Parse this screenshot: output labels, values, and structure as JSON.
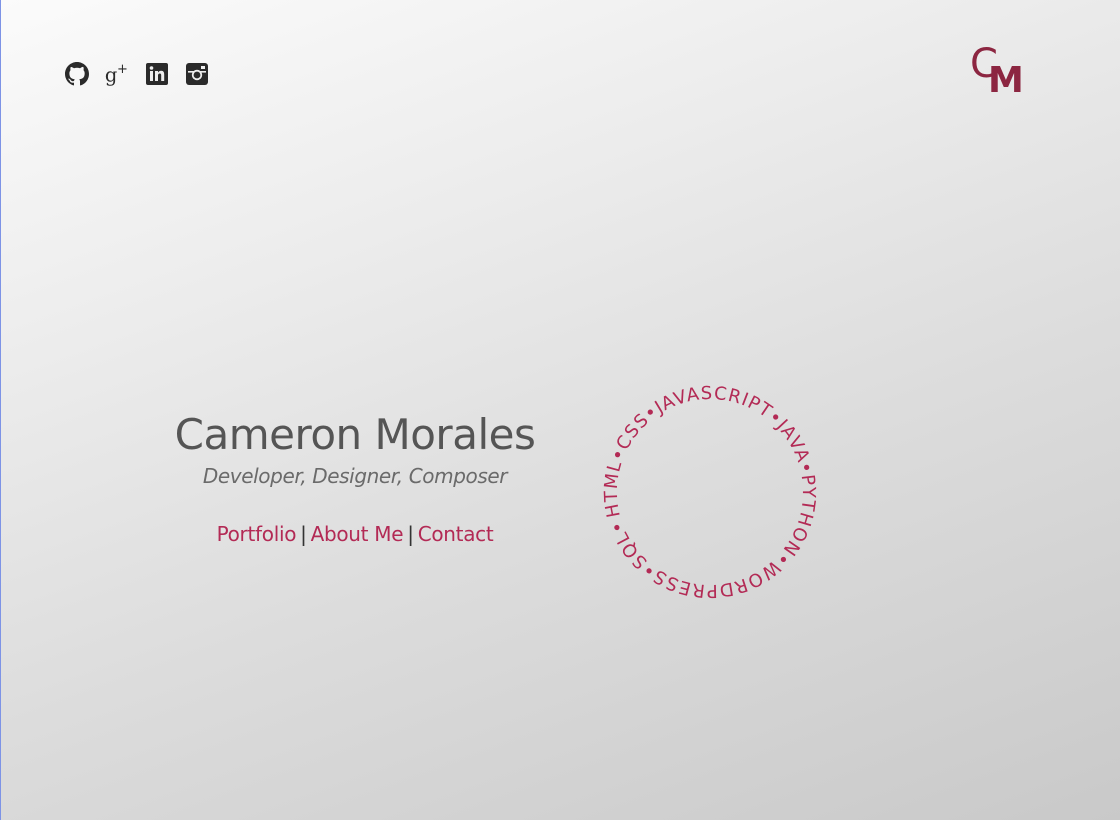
{
  "social": {
    "links": [
      {
        "icon": "github-icon",
        "label": "GitHub"
      },
      {
        "icon": "google-plus-icon",
        "label": "Google+"
      },
      {
        "icon": "linkedin-icon",
        "label": "LinkedIn"
      },
      {
        "icon": "instagram-icon",
        "label": "Instagram"
      }
    ]
  },
  "logo": {
    "first": "C",
    "second": "M"
  },
  "hero": {
    "name": "Cameron Morales",
    "tagline": "Developer, Designer, Composer",
    "nav": {
      "portfolio": "Portfolio",
      "about": "About Me",
      "contact": "Contact",
      "separator": "|"
    }
  },
  "skills_ring": {
    "text": "HTML•CSS•JAVASCRIPT•JAVA•PYTHON•WORDPRESS•SQL•"
  },
  "colors": {
    "accent": "#b32a55",
    "logo": "#8c2641",
    "text": "#555555"
  }
}
